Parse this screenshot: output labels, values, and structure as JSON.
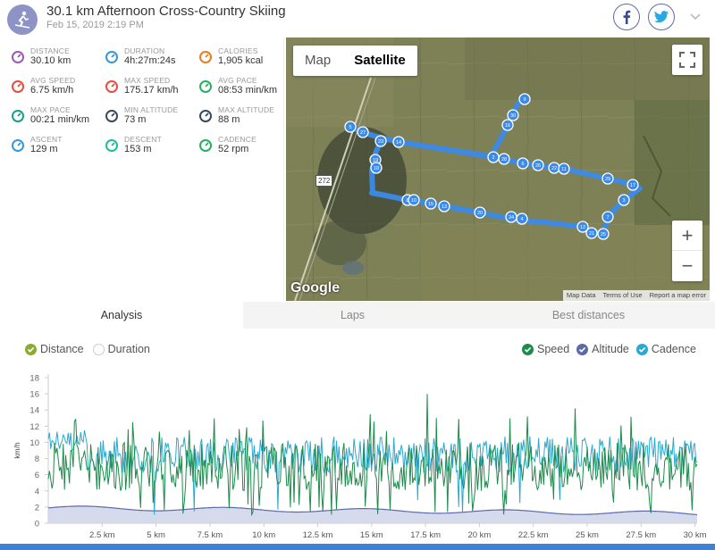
{
  "header": {
    "title": "30.1 km Afternoon Cross-Country Skiing",
    "date": "Feb 15, 2019 2:19 PM",
    "activity_icon": "skiing-icon",
    "facebook_icon": "facebook-icon",
    "twitter_icon": "twitter-icon"
  },
  "stats": [
    {
      "label": "DISTANCE",
      "value": "30.10 km",
      "icon": "distance-icon",
      "color": "#9b59b6"
    },
    {
      "label": "DURATION",
      "value": "4h:27m:24s",
      "icon": "stopwatch-icon",
      "color": "#3498db"
    },
    {
      "label": "CALORIES",
      "value": "1,905 kcal",
      "icon": "flame-icon",
      "color": "#e67e22"
    },
    {
      "label": "AVG SPEED",
      "value": "6.75 km/h",
      "icon": "speedometer-icon",
      "color": "#e74c3c"
    },
    {
      "label": "MAX SPEED",
      "value": "175.17 km/h",
      "icon": "speedometer-icon",
      "color": "#e74c3c"
    },
    {
      "label": "AVG PACE",
      "value": "08:53 min/km",
      "icon": "pace-gauge-icon",
      "color": "#27ae60"
    },
    {
      "label": "MAX PACE",
      "value": "00:21 min/km",
      "icon": "pace-gauge-icon",
      "color": "#16a085"
    },
    {
      "label": "MIN ALTITUDE",
      "value": "73 m",
      "icon": "mountain-icon",
      "color": "#34495e"
    },
    {
      "label": "MAX ALTITUDE",
      "value": "88 m",
      "icon": "mountain-icon",
      "color": "#34495e"
    },
    {
      "label": "ASCENT",
      "value": "129 m",
      "icon": "ascent-icon",
      "color": "#3498db"
    },
    {
      "label": "DESCENT",
      "value": "153 m",
      "icon": "descent-icon",
      "color": "#1abc9c"
    },
    {
      "label": "CADENCE",
      "value": "52 rpm",
      "icon": "cadence-icon",
      "color": "#27ae60"
    }
  ],
  "map": {
    "toggle_map": "Map",
    "toggle_satellite": "Satellite",
    "road_sign": "272",
    "google": "Google",
    "attribution": [
      "Map Data",
      "Terms of Use",
      "Report a map error"
    ],
    "zoom_in": "+",
    "zoom_out": "−",
    "markers": [
      "9",
      "30",
      "16",
      "5",
      "27",
      "23",
      "14",
      "19",
      "18",
      "2",
      "28",
      "6",
      "26",
      "22",
      "11",
      "29",
      "17",
      "3",
      "7",
      "25",
      "21",
      "12",
      "8",
      "10",
      "15",
      "13",
      "20",
      "24",
      "4",
      "1"
    ]
  },
  "tabs": [
    "Analysis",
    "Laps",
    "Best distances"
  ],
  "chart_controls": {
    "x_options": [
      "Distance",
      "Duration"
    ],
    "series_toggles": [
      {
        "label": "Speed",
        "color": "#1e8a4c"
      },
      {
        "label": "Altitude",
        "color": "#5b6aa8"
      },
      {
        "label": "Cadence",
        "color": "#2aa9d0"
      }
    ]
  },
  "chart_data": {
    "type": "line",
    "ylabel": "km/h",
    "ylim": [
      0,
      18
    ],
    "yticks": [
      "0",
      "2",
      "4",
      "6",
      "8",
      "10",
      "12",
      "14",
      "16",
      "18"
    ],
    "xlim": [
      0,
      30.1
    ],
    "xticks": [
      "2.5 km",
      "5 km",
      "7.5 km",
      "10 km",
      "12.5 km",
      "15 km",
      "17.5 km",
      "20 km",
      "22.5 km",
      "25 km",
      "27.5 km",
      "30 km"
    ],
    "xtick_values": [
      2.5,
      5,
      7.5,
      10,
      12.5,
      15,
      17.5,
      20,
      22.5,
      25,
      27.5,
      30
    ],
    "series": [
      {
        "name": "Speed",
        "color": "#1e8a4c"
      },
      {
        "name": "Altitude",
        "color": "#5b6aa8"
      },
      {
        "name": "Cadence",
        "color": "#2aa9d0"
      }
    ]
  }
}
